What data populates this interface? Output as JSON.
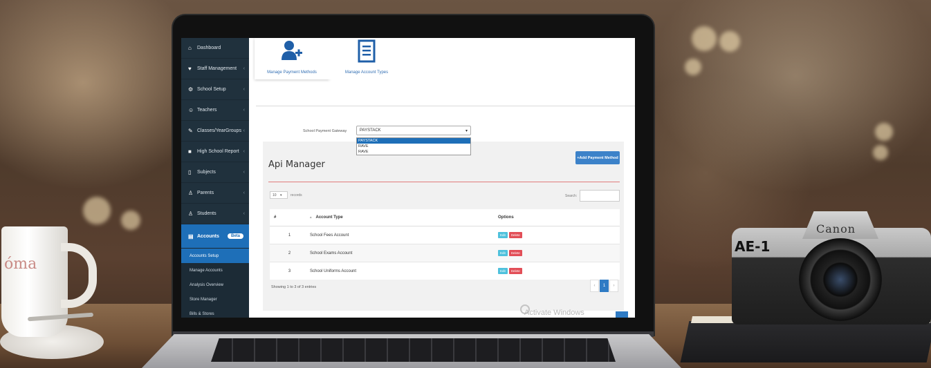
{
  "scene": {
    "cup_text": "óma",
    "camera_brand": "Canon",
    "camera_model": "AE-1"
  },
  "sidebar": {
    "items": [
      {
        "label": "Dashboard",
        "icon": "home-icon"
      },
      {
        "label": "Staff Management",
        "icon": "heart-icon"
      },
      {
        "label": "School Setup",
        "icon": "gear-icon"
      },
      {
        "label": "Teachers",
        "icon": "users-icon"
      },
      {
        "label": "Classes/YearGroups",
        "icon": "edit-icon"
      },
      {
        "label": "High School Report",
        "icon": "report-icon"
      },
      {
        "label": "Subjects",
        "icon": "book-icon"
      },
      {
        "label": "Parents",
        "icon": "user-icon"
      },
      {
        "label": "Students",
        "icon": "student-icon"
      }
    ],
    "active": {
      "label": "Accounts",
      "badge": "Beta"
    },
    "sub_items": [
      "Accounts Setup",
      "Manage Accounts",
      "Analysis Overview",
      "Store Manager",
      "Bills & Stores"
    ]
  },
  "tabs": {
    "manage_payment": "Manage Payment Methods",
    "manage_account_types": "Manage Account Types"
  },
  "gateway": {
    "label": "School Payment Gateway",
    "selected": "PAYSTACK",
    "options": [
      "PAYSTACK",
      "RAVE",
      "RAVE"
    ]
  },
  "panel": {
    "title": "Api Manager",
    "add_button": "+Add Payment Method",
    "length_value": "10",
    "length_label": "records",
    "search_label": "Search:",
    "columns": [
      "#",
      "Account Type",
      "Options"
    ],
    "rows": [
      {
        "num": "1",
        "type": "School Fees Account"
      },
      {
        "num": "2",
        "type": "School Exams Account"
      },
      {
        "num": "3",
        "type": "School Uniforms Account"
      }
    ],
    "edit_label": "Edit",
    "delete_label": "Delete",
    "showing": "Showing 1 to 3 of 3 entries",
    "pager": {
      "prev": "‹",
      "current": "1",
      "next": "›"
    }
  },
  "overlay": {
    "activate": "Activate Windows"
  }
}
